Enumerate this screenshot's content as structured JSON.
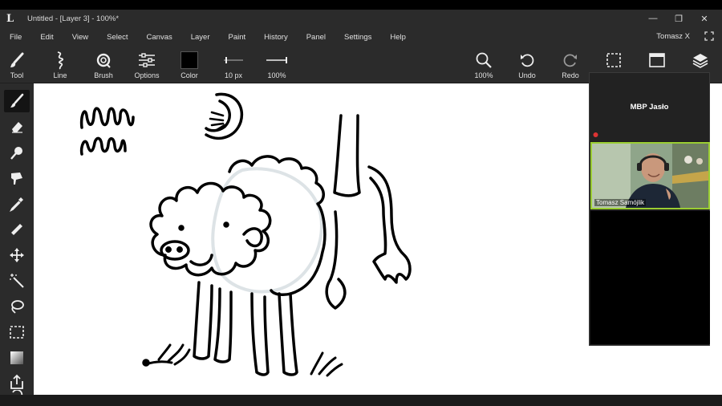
{
  "window": {
    "logo": "L",
    "title": "Untitled - [Layer 3] - 100%*",
    "minimize": "—",
    "restore": "❐",
    "close": "✕"
  },
  "menu": {
    "items": [
      "File",
      "Edit",
      "View",
      "Select",
      "Canvas",
      "Layer",
      "Paint",
      "History",
      "Panel",
      "Settings",
      "Help"
    ],
    "user": "Tomasz X"
  },
  "toolbar": {
    "tool": "Tool",
    "line": "Line",
    "brush": "Brush",
    "options": "Options",
    "color": "Color",
    "brush_size": "10 px",
    "opacity": "100%",
    "zoom": "100%",
    "undo": "Undo",
    "redo": "Redo",
    "color_value": "#000000"
  },
  "left_tools": [
    "brush-tool-icon",
    "eraser-tool-icon",
    "smudge-tool-icon",
    "fill-tool-icon",
    "eyedropper-tool-icon",
    "ruler-tool-icon",
    "move-tool-icon",
    "magic-wand-tool-icon",
    "lasso-tool-icon",
    "rect-select-tool-icon",
    "gradient-tool-icon",
    "export-tool-icon",
    "rotate-tool-icon"
  ],
  "meeting": {
    "room": "MBP Jasło",
    "participant": "Tomasz Samójlik"
  }
}
